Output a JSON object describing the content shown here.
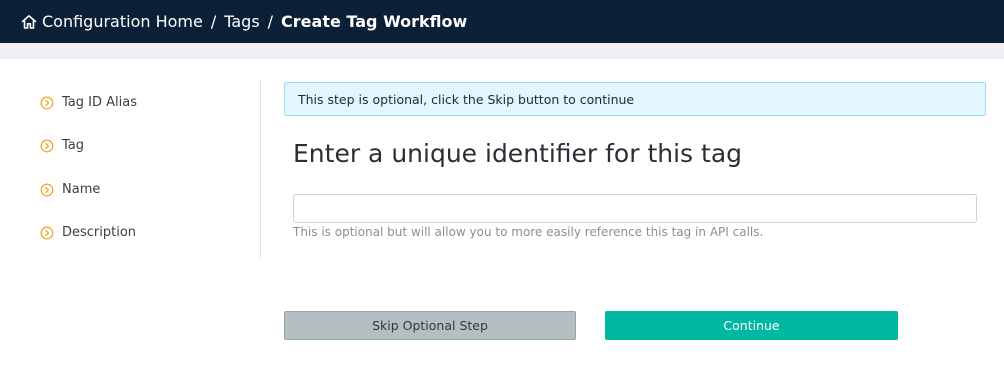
{
  "breadcrumb": {
    "home": "Configuration Home",
    "separator": "/",
    "tags": "Tags",
    "current": "Create Tag Workflow"
  },
  "sidebar": {
    "items": [
      {
        "label": "Tag ID Alias",
        "icon": "chevron-circle-right-icon"
      },
      {
        "label": "Tag",
        "icon": "chevron-circle-right-icon"
      },
      {
        "label": "Name",
        "icon": "chevron-circle-right-icon"
      },
      {
        "label": "Description",
        "icon": "chevron-circle-right-icon"
      }
    ]
  },
  "alert": {
    "text": "This step is optional, click the Skip button to continue"
  },
  "main": {
    "heading": "Enter a unique identifier for this tag",
    "input_value": "",
    "input_placeholder": "",
    "help_text": "This is optional but will allow you to more easily reference this tag in API calls."
  },
  "buttons": {
    "skip_label": "Skip Optional Step",
    "continue_label": "Continue"
  },
  "colors": {
    "topbar": "#0b1f36",
    "step_icon": "#f0a830",
    "alert_bg": "#e3f6fd",
    "alert_border": "#9edcf3",
    "skip_button": "#b5bfc1",
    "continue_button": "#00b8a2"
  }
}
